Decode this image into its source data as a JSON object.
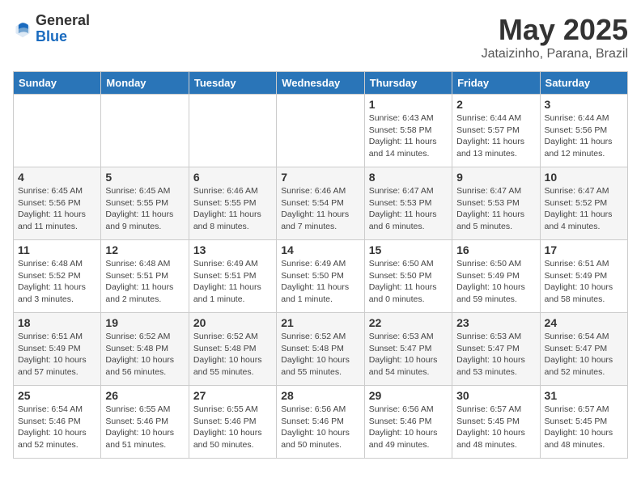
{
  "header": {
    "logo_general": "General",
    "logo_blue": "Blue",
    "title": "May 2025",
    "location": "Jataizinho, Parana, Brazil"
  },
  "days_of_week": [
    "Sunday",
    "Monday",
    "Tuesday",
    "Wednesday",
    "Thursday",
    "Friday",
    "Saturday"
  ],
  "weeks": [
    [
      {
        "day": "",
        "info": ""
      },
      {
        "day": "",
        "info": ""
      },
      {
        "day": "",
        "info": ""
      },
      {
        "day": "",
        "info": ""
      },
      {
        "day": "1",
        "info": "Sunrise: 6:43 AM\nSunset: 5:58 PM\nDaylight: 11 hours and 14 minutes."
      },
      {
        "day": "2",
        "info": "Sunrise: 6:44 AM\nSunset: 5:57 PM\nDaylight: 11 hours and 13 minutes."
      },
      {
        "day": "3",
        "info": "Sunrise: 6:44 AM\nSunset: 5:56 PM\nDaylight: 11 hours and 12 minutes."
      }
    ],
    [
      {
        "day": "4",
        "info": "Sunrise: 6:45 AM\nSunset: 5:56 PM\nDaylight: 11 hours and 11 minutes."
      },
      {
        "day": "5",
        "info": "Sunrise: 6:45 AM\nSunset: 5:55 PM\nDaylight: 11 hours and 9 minutes."
      },
      {
        "day": "6",
        "info": "Sunrise: 6:46 AM\nSunset: 5:55 PM\nDaylight: 11 hours and 8 minutes."
      },
      {
        "day": "7",
        "info": "Sunrise: 6:46 AM\nSunset: 5:54 PM\nDaylight: 11 hours and 7 minutes."
      },
      {
        "day": "8",
        "info": "Sunrise: 6:47 AM\nSunset: 5:53 PM\nDaylight: 11 hours and 6 minutes."
      },
      {
        "day": "9",
        "info": "Sunrise: 6:47 AM\nSunset: 5:53 PM\nDaylight: 11 hours and 5 minutes."
      },
      {
        "day": "10",
        "info": "Sunrise: 6:47 AM\nSunset: 5:52 PM\nDaylight: 11 hours and 4 minutes."
      }
    ],
    [
      {
        "day": "11",
        "info": "Sunrise: 6:48 AM\nSunset: 5:52 PM\nDaylight: 11 hours and 3 minutes."
      },
      {
        "day": "12",
        "info": "Sunrise: 6:48 AM\nSunset: 5:51 PM\nDaylight: 11 hours and 2 minutes."
      },
      {
        "day": "13",
        "info": "Sunrise: 6:49 AM\nSunset: 5:51 PM\nDaylight: 11 hours and 1 minute."
      },
      {
        "day": "14",
        "info": "Sunrise: 6:49 AM\nSunset: 5:50 PM\nDaylight: 11 hours and 1 minute."
      },
      {
        "day": "15",
        "info": "Sunrise: 6:50 AM\nSunset: 5:50 PM\nDaylight: 11 hours and 0 minutes."
      },
      {
        "day": "16",
        "info": "Sunrise: 6:50 AM\nSunset: 5:49 PM\nDaylight: 10 hours and 59 minutes."
      },
      {
        "day": "17",
        "info": "Sunrise: 6:51 AM\nSunset: 5:49 PM\nDaylight: 10 hours and 58 minutes."
      }
    ],
    [
      {
        "day": "18",
        "info": "Sunrise: 6:51 AM\nSunset: 5:49 PM\nDaylight: 10 hours and 57 minutes."
      },
      {
        "day": "19",
        "info": "Sunrise: 6:52 AM\nSunset: 5:48 PM\nDaylight: 10 hours and 56 minutes."
      },
      {
        "day": "20",
        "info": "Sunrise: 6:52 AM\nSunset: 5:48 PM\nDaylight: 10 hours and 55 minutes."
      },
      {
        "day": "21",
        "info": "Sunrise: 6:52 AM\nSunset: 5:48 PM\nDaylight: 10 hours and 55 minutes."
      },
      {
        "day": "22",
        "info": "Sunrise: 6:53 AM\nSunset: 5:47 PM\nDaylight: 10 hours and 54 minutes."
      },
      {
        "day": "23",
        "info": "Sunrise: 6:53 AM\nSunset: 5:47 PM\nDaylight: 10 hours and 53 minutes."
      },
      {
        "day": "24",
        "info": "Sunrise: 6:54 AM\nSunset: 5:47 PM\nDaylight: 10 hours and 52 minutes."
      }
    ],
    [
      {
        "day": "25",
        "info": "Sunrise: 6:54 AM\nSunset: 5:46 PM\nDaylight: 10 hours and 52 minutes."
      },
      {
        "day": "26",
        "info": "Sunrise: 6:55 AM\nSunset: 5:46 PM\nDaylight: 10 hours and 51 minutes."
      },
      {
        "day": "27",
        "info": "Sunrise: 6:55 AM\nSunset: 5:46 PM\nDaylight: 10 hours and 50 minutes."
      },
      {
        "day": "28",
        "info": "Sunrise: 6:56 AM\nSunset: 5:46 PM\nDaylight: 10 hours and 50 minutes."
      },
      {
        "day": "29",
        "info": "Sunrise: 6:56 AM\nSunset: 5:46 PM\nDaylight: 10 hours and 49 minutes."
      },
      {
        "day": "30",
        "info": "Sunrise: 6:57 AM\nSunset: 5:45 PM\nDaylight: 10 hours and 48 minutes."
      },
      {
        "day": "31",
        "info": "Sunrise: 6:57 AM\nSunset: 5:45 PM\nDaylight: 10 hours and 48 minutes."
      }
    ]
  ]
}
